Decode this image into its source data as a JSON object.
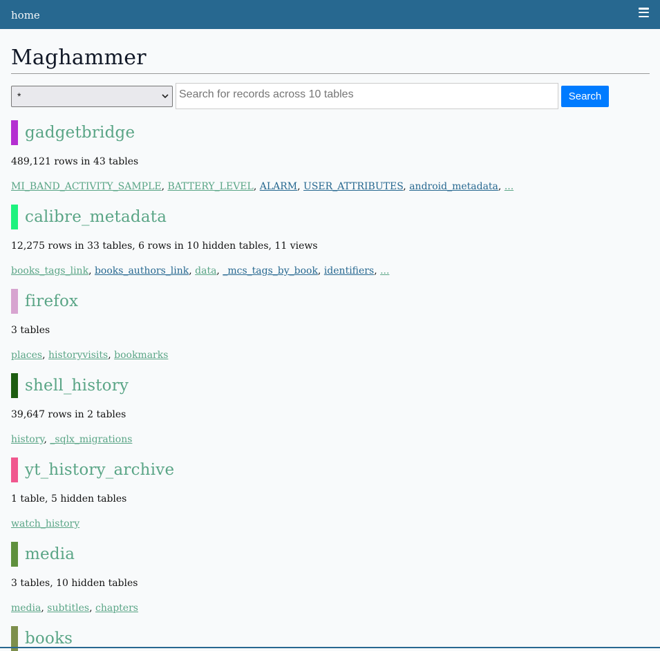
{
  "nav": {
    "home": "home",
    "menu_icon": "hamburger-menu-icon"
  },
  "page": {
    "title": "Maghammer"
  },
  "search": {
    "select_value": "*",
    "placeholder": "Search for records across 10 tables",
    "button": "Search"
  },
  "databases": [
    {
      "name": "gadgetbridge",
      "color": "#b42fd1",
      "summary": "489,121 rows in 43 tables",
      "tables": [
        {
          "label": "MI_BAND_ACTIVITY_SAMPLE",
          "visited": true
        },
        {
          "label": "BATTERY_LEVEL",
          "visited": true
        },
        {
          "label": "ALARM",
          "visited": false
        },
        {
          "label": "USER_ATTRIBUTES",
          "visited": false
        },
        {
          "label": "android_metadata",
          "visited": false
        },
        {
          "label": "...",
          "visited": true
        }
      ]
    },
    {
      "name": "calibre_metadata",
      "color": "#1ef27e",
      "summary": "12,275 rows in 33 tables, 6 rows in 10 hidden tables, 11 views",
      "tables": [
        {
          "label": "books_tags_link",
          "visited": true
        },
        {
          "label": "books_authors_link",
          "visited": false
        },
        {
          "label": "data",
          "visited": true
        },
        {
          "label": "_mcs_tags_by_book",
          "visited": false
        },
        {
          "label": "identifiers",
          "visited": false
        },
        {
          "label": "...",
          "visited": true
        }
      ]
    },
    {
      "name": "firefox",
      "color": "#d7a4d0",
      "summary": "3 tables",
      "tables": [
        {
          "label": "places",
          "visited": true
        },
        {
          "label": "historyvisits",
          "visited": true
        },
        {
          "label": "bookmarks",
          "visited": true
        }
      ]
    },
    {
      "name": "shell_history",
      "color": "#1d5d10",
      "summary": "39,647 rows in 2 tables",
      "tables": [
        {
          "label": "history",
          "visited": true
        },
        {
          "label": "_sqlx_migrations",
          "visited": true
        }
      ]
    },
    {
      "name": "yt_history_archive",
      "color": "#f0578e",
      "summary": "1 table, 5 hidden tables",
      "tables": [
        {
          "label": "watch_history",
          "visited": true
        }
      ]
    },
    {
      "name": "media",
      "color": "#5f903d",
      "summary": "3 tables, 10 hidden tables",
      "tables": [
        {
          "label": "media",
          "visited": true
        },
        {
          "label": "subtitles",
          "visited": true
        },
        {
          "label": "chapters",
          "visited": true
        }
      ]
    },
    {
      "name": "books",
      "color": "#7d8f4c",
      "summary": "",
      "tables": []
    }
  ]
}
